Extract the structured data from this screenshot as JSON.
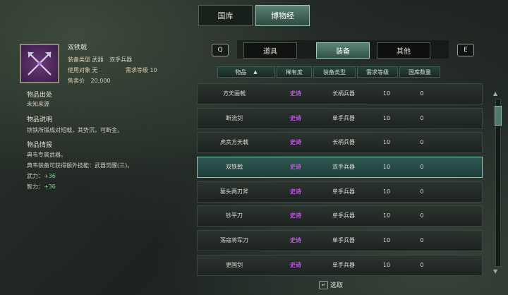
{
  "top_tabs": [
    {
      "label": "国库"
    },
    {
      "label": "博物经"
    }
  ],
  "item": {
    "name": "双铁戟",
    "type_label": "装备类型",
    "type_value": "武器",
    "type_subvalue": "双手兵器",
    "target_label": "使用对象",
    "target_value": "无",
    "req_label": "需求等级",
    "req_value": "10",
    "price_label": "售卖价",
    "price_value": "20,000",
    "origin_title": "物品出处",
    "origin_text": "未知来源",
    "desc_title": "物品说明",
    "desc_text": "镔铁所锻成对短戟，其势沉，可断金。",
    "intel_title": "物品情报",
    "intel_line1": "典韦专属武器。",
    "intel_line2": "典韦装备可获得额外技能：武器觉醒(三)。",
    "stat1_label": "武力：",
    "stat1_value": "+36",
    "stat2_label": "智力：",
    "stat2_value": "+36"
  },
  "nav_keys": {
    "left": "Q",
    "right": "E"
  },
  "category_tabs": [
    {
      "label": "道具"
    },
    {
      "label": "装备"
    },
    {
      "label": "其他"
    }
  ],
  "columns": [
    "物品",
    "稀有度",
    "装备类型",
    "需求等级",
    "国库数量"
  ],
  "sort_icon": "sort-icon",
  "rows": [
    {
      "name": "方天画戟",
      "rarity": "史诗",
      "type": "长柄兵器",
      "level": "10",
      "count": "0"
    },
    {
      "name": "断流剑",
      "rarity": "史诗",
      "type": "单手兵器",
      "level": "10",
      "count": "0"
    },
    {
      "name": "虎贲方天戟",
      "rarity": "史诗",
      "type": "长柄兵器",
      "level": "10",
      "count": "0"
    },
    {
      "name": "双铁戟",
      "rarity": "史诗",
      "type": "双手兵器",
      "level": "10",
      "count": "0"
    },
    {
      "name": "錾头两刃斧",
      "rarity": "史诗",
      "type": "单手兵器",
      "level": "10",
      "count": "0"
    },
    {
      "name": "钞平刀",
      "rarity": "史诗",
      "type": "单手兵器",
      "level": "10",
      "count": "0"
    },
    {
      "name": "荡寇将军刀",
      "rarity": "史诗",
      "type": "单手兵器",
      "level": "10",
      "count": "0"
    },
    {
      "name": "更国剑",
      "rarity": "史诗",
      "type": "单手兵器",
      "level": "10",
      "count": "0"
    }
  ],
  "hint": {
    "key": "↵",
    "label": "选取"
  },
  "colors": {
    "rarity_epic": "#c456e6",
    "stat_bonus": "#6fdc8a",
    "accent": "#5c8677"
  }
}
